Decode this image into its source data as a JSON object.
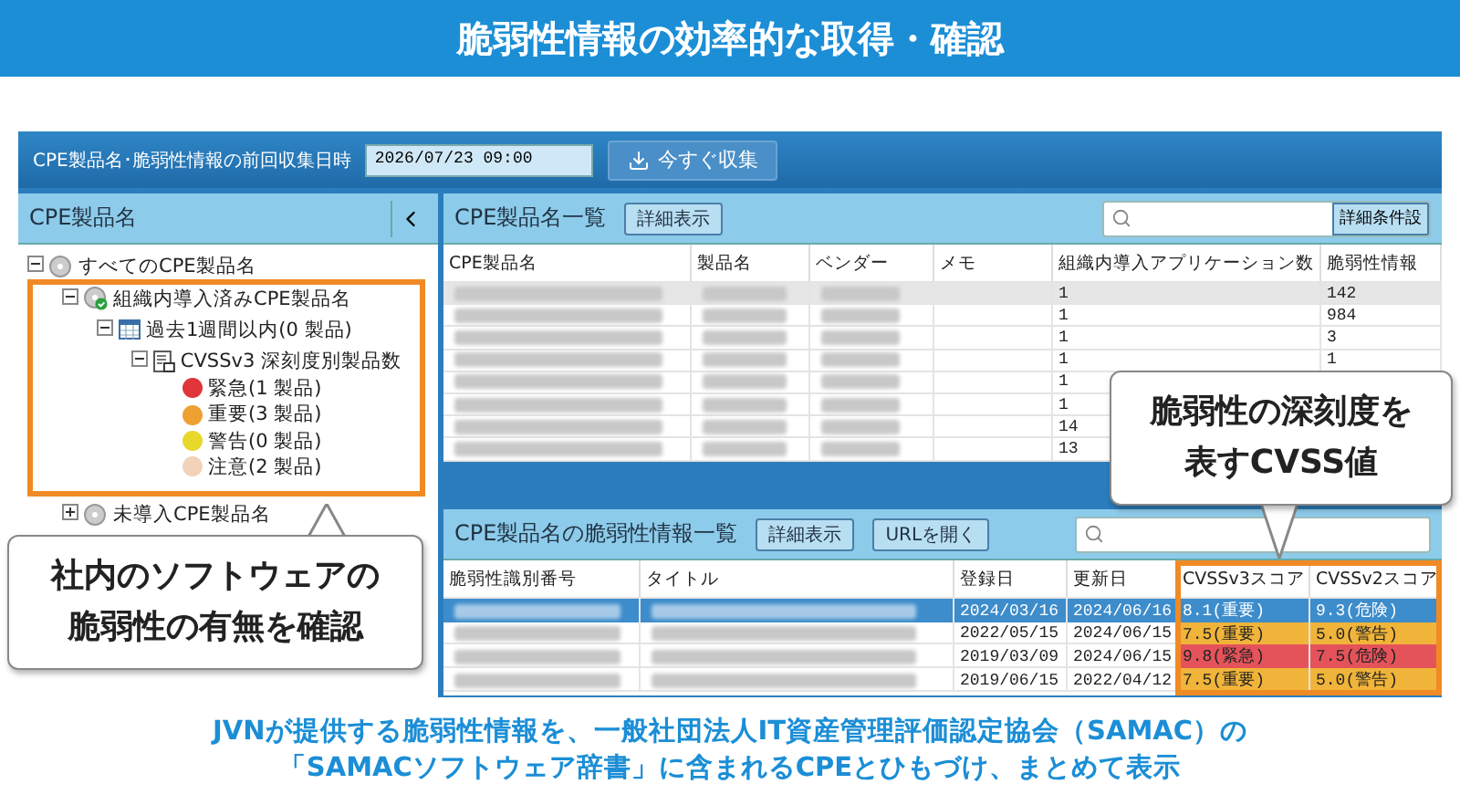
{
  "banner": {
    "title": "脆弱性情報の効率的な取得・確認"
  },
  "toolbar": {
    "label": "CPE製品名･脆弱性情報の前回収集日時",
    "value": "2026/07/23 09:00",
    "button": "今すぐ収集"
  },
  "tree_panel": {
    "title": "CPE製品名",
    "tree": [
      {
        "label": "すべてのCPE製品名",
        "kind": "disc",
        "expanded": true,
        "highlighted": false,
        "children": [
          {
            "label": "組織内導入済みCPE製品名",
            "kind": "disc-check",
            "expanded": true,
            "highlighted": true,
            "children": [
              {
                "label": "過去1週間以内(0 製品)",
                "kind": "calendar",
                "expanded": true,
                "highlighted": false,
                "children": [
                  {
                    "label": "CVSSv3 深刻度別製品数",
                    "kind": "report",
                    "expanded": true,
                    "highlighted": false,
                    "children": [
                      {
                        "label": "緊急(1 製品)",
                        "kind": "dot",
                        "color": "#e0353a"
                      },
                      {
                        "label": "重要(3 製品)",
                        "kind": "dot",
                        "color": "#eea030"
                      },
                      {
                        "label": "警告(0 製品)",
                        "kind": "dot",
                        "color": "#e8d82a"
                      },
                      {
                        "label": "注意(2 製品)",
                        "kind": "dot",
                        "color": "#f2d2b8"
                      }
                    ]
                  }
                ]
              }
            ]
          },
          {
            "label": "未導入CPE製品名",
            "kind": "disc",
            "expanded": false,
            "highlighted": false
          }
        ]
      }
    ]
  },
  "product_panel": {
    "title": "CPE製品名一覧",
    "button": "詳細表示",
    "search_button": "詳細条件設",
    "columns": [
      "CPE製品名",
      "製品名",
      "ベンダー",
      "メモ",
      "組織内導入アプリケーション数",
      "脆弱性情報"
    ],
    "rows": [
      {
        "selected": true,
        "app_count": "1",
        "vuln_count": "142"
      },
      {
        "selected": false,
        "app_count": "1",
        "vuln_count": "984"
      },
      {
        "selected": false,
        "app_count": "1",
        "vuln_count": "3"
      },
      {
        "selected": false,
        "app_count": "1",
        "vuln_count": "1"
      },
      {
        "selected": false,
        "app_count": "1"
      },
      {
        "selected": false,
        "app_count": "1"
      },
      {
        "selected": false,
        "app_count": "14"
      },
      {
        "selected": false,
        "app_count": "13"
      }
    ]
  },
  "vuln_panel": {
    "title": "CPE製品名の脆弱性情報一覧",
    "buttons": [
      "詳細表示",
      "URLを開く"
    ],
    "columns": [
      "脆弱性識別番号",
      "タイトル",
      "登録日",
      "更新日",
      "CVSSv3スコア",
      "CVSSv2スコア"
    ],
    "rows": [
      {
        "selected": true,
        "registered": "2024/03/16",
        "updated": "2024/06/16",
        "cvss3": {
          "text": "8.1(重要)"
        },
        "cvss2": {
          "text": "9.3(危険)"
        }
      },
      {
        "selected": false,
        "registered": "2022/05/15",
        "updated": "2024/06/15",
        "cvss3": {
          "text": "7.5(重要)",
          "color": "#f0b43a"
        },
        "cvss2": {
          "text": "5.0(警告)",
          "color": "#f0b43a"
        }
      },
      {
        "selected": false,
        "registered": "2019/03/09",
        "updated": "2024/06/15",
        "cvss3": {
          "text": "9.8(緊急)",
          "color": "#e5535a"
        },
        "cvss2": {
          "text": "7.5(危険)",
          "color": "#e5535a"
        }
      },
      {
        "selected": false,
        "registered": "2019/06/15",
        "updated": "2022/04/12",
        "cvss3": {
          "text": "7.5(重要)",
          "color": "#f0b43a"
        },
        "cvss2": {
          "text": "5.0(警告)",
          "color": "#f0b43a"
        }
      }
    ]
  },
  "callouts": [
    {
      "lines": [
        "社内のソフトウェアの",
        "脆弱性の有無を確認"
      ]
    },
    {
      "lines": [
        "脆弱性の深刻度を",
        "表すCVSS値"
      ]
    }
  ],
  "caption": [
    "JVNが提供する脆弱性情報を、一般社団法人IT資産管理評価認定協会（SAMAC）の",
    "「SAMACソフトウェア辞書」に含まれるCPEとひもづけ、まとめて表示"
  ]
}
